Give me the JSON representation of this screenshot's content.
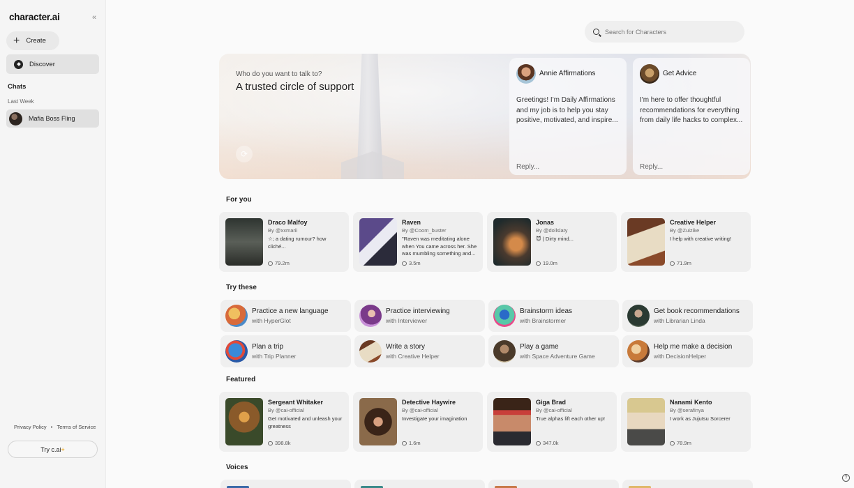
{
  "sidebar": {
    "logo": "character.ai",
    "collapse_icon": "«",
    "create_label": "Create",
    "discover_label": "Discover",
    "chats_title": "Chats",
    "last_week": "Last Week",
    "chats": [
      {
        "name": "Mafia Boss Fling"
      }
    ],
    "privacy": "Privacy Policy",
    "separator": "•",
    "terms": "Terms of Service",
    "try_label": "Try  c.ai",
    "try_plus": "+"
  },
  "search": {
    "placeholder": "Search for Characters"
  },
  "hero": {
    "eyebrow": "Who do you want to talk to?",
    "headline": "A trusted circle of support",
    "cards": [
      {
        "name": "Annie Affirmations",
        "message": "Greetings! I'm Daily Affirmations and my job is to help you stay positive, motivated, and inspire...",
        "reply": "Reply..."
      },
      {
        "name": "Get Advice",
        "message": "I'm here to offer thoughtful recommendations for everything from daily life hacks to complex...",
        "reply": "Reply..."
      }
    ]
  },
  "for_you": {
    "title": "For you",
    "cards": [
      {
        "title": "Draco Malfoy",
        "by": "By @xxmarii",
        "desc": "☆; a dating rumour? how cliché...",
        "count": "79.2m"
      },
      {
        "title": "Raven",
        "by": "By @Coom_buster",
        "desc": "\"Raven was meditating alone when You came across her. She was mumbling something and...",
        "count": "3.5m"
      },
      {
        "title": "Jonas",
        "by": "By @dollslaty",
        "desc": "😈 | Dirty mind...",
        "count": "19.0m"
      },
      {
        "title": "Creative Helper",
        "by": "By @Zuizike",
        "desc": "I help with creative writing!",
        "count": "71.9m"
      }
    ]
  },
  "try_these": {
    "title": "Try these",
    "items": [
      {
        "title": "Practice a new language",
        "sub": "with HyperGlot"
      },
      {
        "title": "Practice interviewing",
        "sub": "with Interviewer"
      },
      {
        "title": "Brainstorm ideas",
        "sub": "with Brainstormer"
      },
      {
        "title": "Get book recommendations",
        "sub": "with Librarian Linda"
      },
      {
        "title": "Plan a trip",
        "sub": "with Trip Planner"
      },
      {
        "title": "Write a story",
        "sub": "with Creative Helper"
      },
      {
        "title": "Play a game",
        "sub": "with Space Adventure Game"
      },
      {
        "title": "Help me make a decision",
        "sub": "with DecisionHelper"
      }
    ]
  },
  "featured": {
    "title": "Featured",
    "cards": [
      {
        "title": "Sergeant Whitaker",
        "by": "By @cai-official",
        "desc": "Get motivated and unleash your greatness",
        "count": "398.8k"
      },
      {
        "title": "Detective Haywire",
        "by": "By @cai-official",
        "desc": "Investigate your imagination",
        "count": "1.6m"
      },
      {
        "title": "Giga Brad",
        "by": "By @cai-official",
        "desc": "True alphas lift each other up!",
        "count": "347.0k"
      },
      {
        "title": "Nanami Kento",
        "by": "By @serafinya",
        "desc": "I work as Jujutsu Sorcerer",
        "count": "78.9m"
      }
    ]
  },
  "voices": {
    "title": "Voices"
  },
  "help_icon": "?"
}
